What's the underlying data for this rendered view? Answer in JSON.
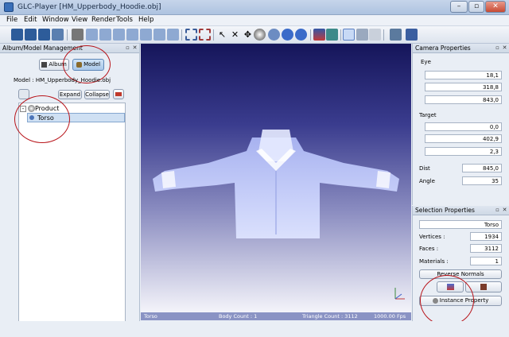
{
  "window": {
    "title": "GLC-Player [HM_Upperbody_Hoodie.obj]",
    "minimize": "–",
    "restore": "▫",
    "close": "✕"
  },
  "menu": [
    "File",
    "Edit",
    "Window",
    "View",
    "Render",
    "Tools",
    "Help"
  ],
  "left_panel": {
    "title": "Album/Model Management",
    "album_button": "Album",
    "model_button": "Model",
    "model_label": "Model : HM_Upperbody_Hoodie.obj",
    "expand_button": "Expand",
    "collapse_button": "Collapse",
    "tree": {
      "root": "Product",
      "child": "Torso"
    }
  },
  "viewport": {
    "selected": "Torso",
    "body_count": "Body Count : 1",
    "triangle_count": "Triangle Count : 3112",
    "fps": "1000.00 Fps"
  },
  "camera": {
    "title": "Camera Properties",
    "eye_label": "Eye",
    "eye": [
      "18,1",
      "318,8",
      "843,0"
    ],
    "target_label": "Target",
    "target": [
      "0,0",
      "402,9",
      "2,3"
    ],
    "dist_label": "Dist",
    "dist": "845,0",
    "angle_label": "Angle",
    "angle": "35"
  },
  "selection": {
    "title": "Selection Properties",
    "name": "Torso",
    "vertices_label": "Vertices :",
    "vertices": "1934",
    "faces_label": "Faces :",
    "faces": "3112",
    "materials_label": "Materials :",
    "materials": "1",
    "reverse_normals": "Reverse Normals",
    "instance_property": "Instance Property"
  },
  "colors": {
    "annotation_circle": "#b8141a",
    "viewport_top": "#15155a",
    "viewport_bottom": "#f4f4fa",
    "model": "#cfd8ff"
  }
}
